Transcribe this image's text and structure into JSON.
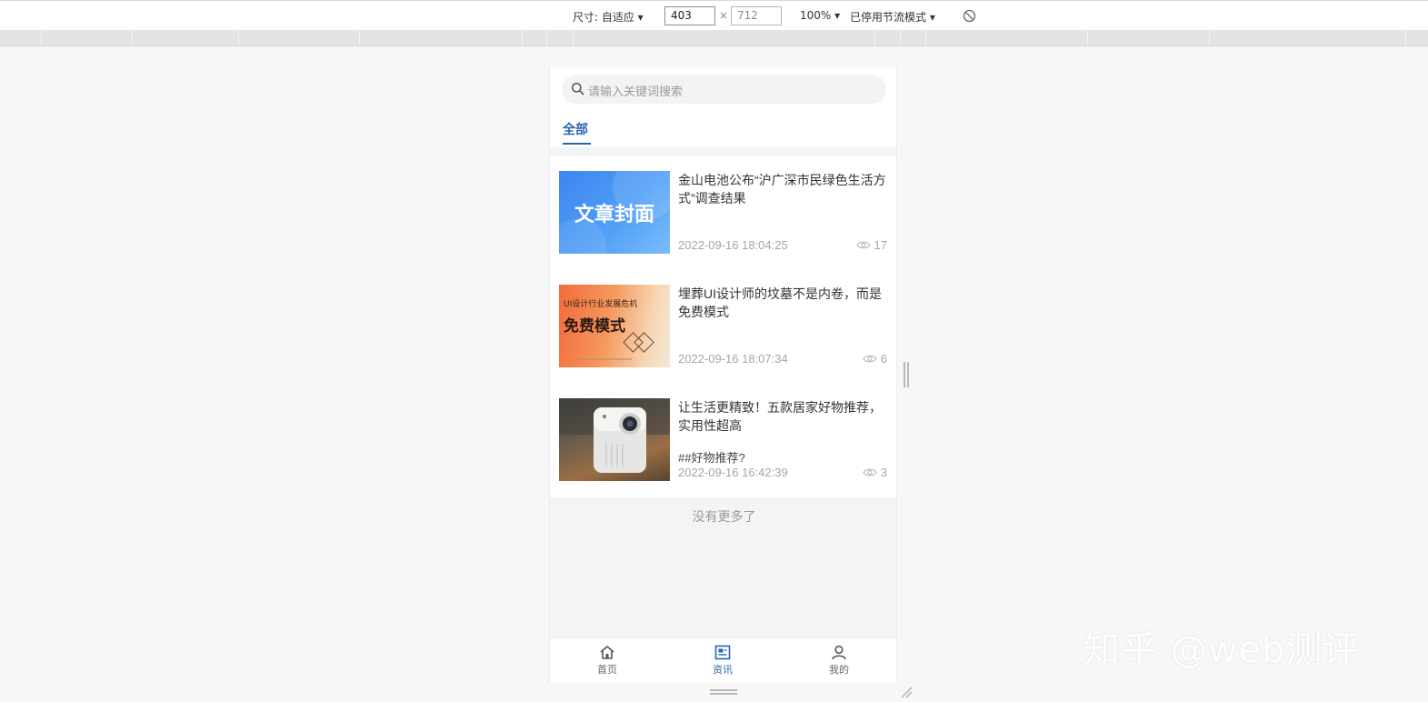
{
  "devtools": {
    "dimensions_label": "尺寸: 自适应 ▾",
    "width": "403",
    "times": "×",
    "height": "712",
    "zoom": "100% ▾",
    "throttle": "已停用节流模式 ▾"
  },
  "search": {
    "placeholder": "请输入关键词搜索"
  },
  "tabs": [
    {
      "label": "全部",
      "active": true
    }
  ],
  "articles": [
    {
      "title": "金山电池公布“沪广深市民绿色生活方式”调查结果",
      "date": "2022-09-16 18:04:25",
      "views": "17",
      "thumb_text": "文章封面"
    },
    {
      "title": "埋葬UI设计师的坟墓不是内卷，而是免费模式",
      "date": "2022-09-16 18:07:34",
      "views": "6",
      "thumb_top": "UI设计行业发展危机",
      "thumb_main": "免费模式"
    },
    {
      "title": "让生活更精致！五款居家好物推荐，实用性超高",
      "tag": "##好物推荐?",
      "date": "2022-09-16 16:42:39",
      "views": "3"
    }
  ],
  "no_more": "没有更多了",
  "tabbar": [
    {
      "label": "首页",
      "icon": "home-icon"
    },
    {
      "label": "资讯",
      "icon": "news-icon",
      "active": true
    },
    {
      "label": "我的",
      "icon": "user-icon"
    }
  ],
  "watermark": "知乎 @web测评",
  "colors": {
    "accent": "#2b63b4",
    "background": "#f3f4f6",
    "muted": "#a5a5a5"
  }
}
